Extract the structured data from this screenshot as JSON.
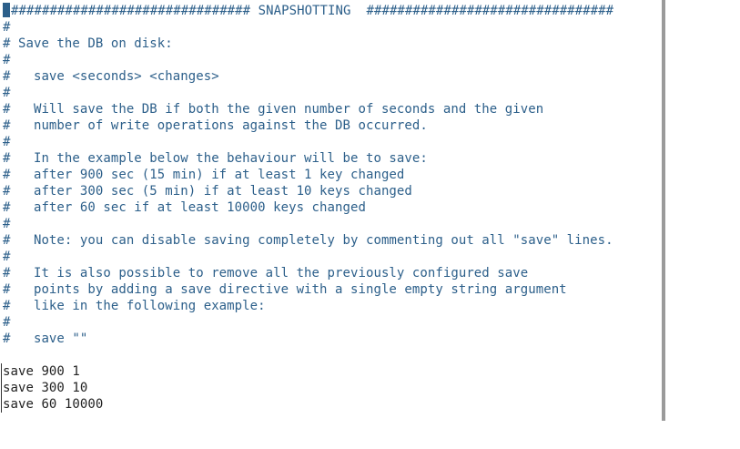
{
  "editor": {
    "lines": [
      {
        "text": "################################ SNAPSHOTTING  ################################",
        "kind": "comment"
      },
      {
        "text": "#",
        "kind": "comment"
      },
      {
        "text": "# Save the DB on disk:",
        "kind": "comment"
      },
      {
        "text": "#",
        "kind": "comment"
      },
      {
        "text": "#   save <seconds> <changes>",
        "kind": "comment"
      },
      {
        "text": "#",
        "kind": "comment"
      },
      {
        "text": "#   Will save the DB if both the given number of seconds and the given",
        "kind": "comment"
      },
      {
        "text": "#   number of write operations against the DB occurred.",
        "kind": "comment"
      },
      {
        "text": "#",
        "kind": "comment"
      },
      {
        "text": "#   In the example below the behaviour will be to save:",
        "kind": "comment"
      },
      {
        "text": "#   after 900 sec (15 min) if at least 1 key changed",
        "kind": "comment"
      },
      {
        "text": "#   after 300 sec (5 min) if at least 10 keys changed",
        "kind": "comment"
      },
      {
        "text": "#   after 60 sec if at least 10000 keys changed",
        "kind": "comment"
      },
      {
        "text": "#",
        "kind": "comment"
      },
      {
        "text": "#   Note: you can disable saving completely by commenting out all \"save\" lines.",
        "kind": "comment"
      },
      {
        "text": "#",
        "kind": "comment"
      },
      {
        "text": "#   It is also possible to remove all the previously configured save",
        "kind": "comment"
      },
      {
        "text": "#   points by adding a save directive with a single empty string argument",
        "kind": "comment"
      },
      {
        "text": "#   like in the following example:",
        "kind": "comment"
      },
      {
        "text": "#",
        "kind": "comment"
      },
      {
        "text": "#   save \"\"",
        "kind": "comment"
      },
      {
        "text": "",
        "kind": "code"
      },
      {
        "text": "save 900 1",
        "kind": "code"
      },
      {
        "text": "save 300 10",
        "kind": "code"
      },
      {
        "text": "save 60 10000",
        "kind": "code"
      }
    ]
  },
  "colors": {
    "comment": "#2c5f8a",
    "code": "#222222",
    "background": "#ffffff",
    "scrollbar": "#9a9a9a"
  }
}
